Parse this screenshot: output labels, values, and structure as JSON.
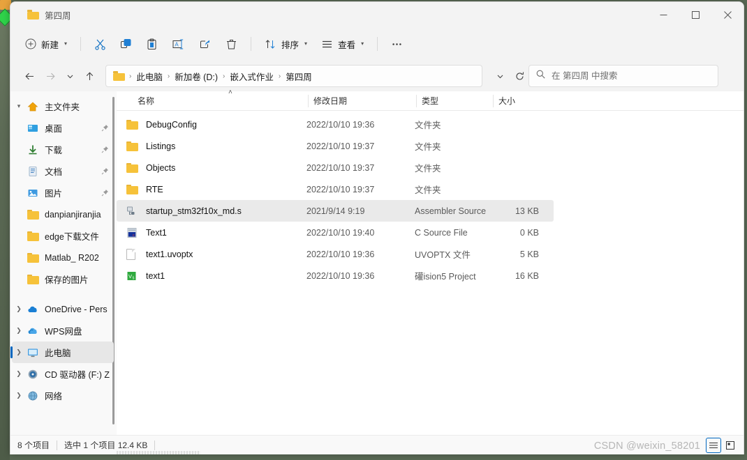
{
  "window": {
    "tab_title": "第四周",
    "minimize_label": "最小化",
    "maximize_label": "最大化",
    "close_label": "关闭"
  },
  "toolbar": {
    "new_label": "新建",
    "cut_label": "剪切",
    "copy_label": "复制",
    "paste_label": "粘贴",
    "rename_label": "重命名",
    "share_label": "共享",
    "delete_label": "删除",
    "sort_label": "排序",
    "view_label": "查看",
    "more_label": "查看更多"
  },
  "navigation": {
    "back_label": "后退",
    "forward_label": "前进",
    "recent_label": "最近浏览位置",
    "up_label": "向上"
  },
  "address": {
    "crumbs": [
      "此电脑",
      "新加卷 (D:)",
      "嵌入式作业",
      "第四周"
    ],
    "separator": "›",
    "dropdown_label": "历史记录",
    "refresh_label": "刷新"
  },
  "search": {
    "placeholder": "在 第四周 中搜索",
    "value": ""
  },
  "sidebar": {
    "items": [
      {
        "label": "主文件夹",
        "icon": "home-icon",
        "expander": "expanded",
        "indent": false,
        "pinned": false,
        "selected": false
      },
      {
        "label": "桌面",
        "icon": "desktop-icon",
        "expander": "none",
        "indent": true,
        "pinned": true,
        "selected": false
      },
      {
        "label": "下载",
        "icon": "download-icon",
        "expander": "none",
        "indent": true,
        "pinned": true,
        "selected": false
      },
      {
        "label": "文档",
        "icon": "document-icon",
        "expander": "none",
        "indent": true,
        "pinned": true,
        "selected": false
      },
      {
        "label": "图片",
        "icon": "pictures-icon",
        "expander": "none",
        "indent": true,
        "pinned": true,
        "selected": false
      },
      {
        "label": "danpianjiranjia",
        "icon": "folder-icon",
        "expander": "none",
        "indent": true,
        "pinned": false,
        "selected": false
      },
      {
        "label": "edge下载文件",
        "icon": "folder-icon",
        "expander": "none",
        "indent": true,
        "pinned": false,
        "selected": false
      },
      {
        "label": "Matlab_ R202",
        "icon": "folder-icon",
        "expander": "none",
        "indent": true,
        "pinned": false,
        "selected": false
      },
      {
        "label": "保存的图片",
        "icon": "folder-icon",
        "expander": "none",
        "indent": true,
        "pinned": false,
        "selected": false
      },
      {
        "label": "OneDrive - Pers",
        "icon": "onedrive-icon",
        "expander": "collapsed",
        "indent": false,
        "pinned": false,
        "selected": false
      },
      {
        "label": "WPS网盘",
        "icon": "wps-cloud-icon",
        "expander": "collapsed",
        "indent": false,
        "pinned": false,
        "selected": false
      },
      {
        "label": "此电脑",
        "icon": "this-pc-icon",
        "expander": "collapsed",
        "indent": false,
        "pinned": false,
        "selected": true
      },
      {
        "label": "CD 驱动器 (F:) Z",
        "icon": "cd-drive-icon",
        "expander": "collapsed",
        "indent": false,
        "pinned": false,
        "selected": false
      },
      {
        "label": "网络",
        "icon": "network-icon",
        "expander": "collapsed",
        "indent": false,
        "pinned": false,
        "selected": false
      }
    ]
  },
  "filelist": {
    "columns": {
      "name": "名称",
      "date": "修改日期",
      "type": "类型",
      "size": "大小"
    },
    "sort": {
      "column": "名称",
      "direction": "ascending",
      "caret": "˄"
    },
    "rows": [
      {
        "name": "DebugConfig",
        "date": "2022/10/10 19:36",
        "type": "文件夹",
        "size": "",
        "icon": "folder-icon",
        "selected": false
      },
      {
        "name": "Listings",
        "date": "2022/10/10 19:37",
        "type": "文件夹",
        "size": "",
        "icon": "folder-icon",
        "selected": false
      },
      {
        "name": "Objects",
        "date": "2022/10/10 19:37",
        "type": "文件夹",
        "size": "",
        "icon": "folder-icon",
        "selected": false
      },
      {
        "name": "RTE",
        "date": "2022/10/10 19:37",
        "type": "文件夹",
        "size": "",
        "icon": "folder-icon",
        "selected": false
      },
      {
        "name": "startup_stm32f10x_md.s",
        "date": "2021/9/14 9:19",
        "type": "Assembler Source",
        "size": "13 KB",
        "icon": "assembler-file-icon",
        "selected": true
      },
      {
        "name": "Text1",
        "date": "2022/10/10 19:40",
        "type": "C Source File",
        "size": "0 KB",
        "icon": "c-source-file-icon",
        "selected": false
      },
      {
        "name": "text1.uvoptx",
        "date": "2022/10/10 19:36",
        "type": "UVOPTX 文件",
        "size": "5 KB",
        "icon": "generic-file-icon",
        "selected": false
      },
      {
        "name": "text1",
        "date": "2022/10/10 19:36",
        "type": "礶ision5 Project",
        "size": "16 KB",
        "icon": "uvision-project-icon",
        "selected": false
      }
    ]
  },
  "status": {
    "item_count": "8 个项目",
    "selection": "选中 1 个项目  12.4 KB",
    "details_view_label": "详细信息视图",
    "large_icons_view_label": "大图标视图"
  },
  "watermark": "CSDN @weixin_58201",
  "colors": {
    "accent": "#0067c0",
    "folder": "#f6c23a",
    "selection": "#eaeaea",
    "close_hover": "#e81123"
  }
}
